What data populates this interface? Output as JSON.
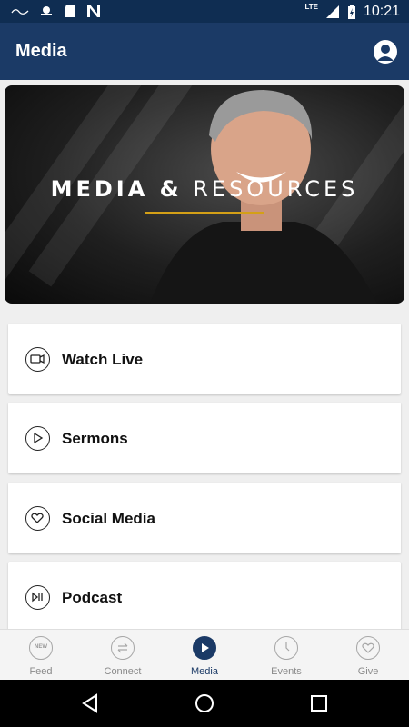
{
  "status_bar": {
    "network": "LTE",
    "time": "10:21"
  },
  "app_bar": {
    "title": "Media",
    "profile_icon": "account-circle-icon"
  },
  "hero": {
    "title_bold": "MEDIA &",
    "title_light": "RESOURCES",
    "accent_color": "#d4a017"
  },
  "menu": [
    {
      "label": "Watch Live",
      "icon": "video-camera-icon"
    },
    {
      "label": "Sermons",
      "icon": "play-icon"
    },
    {
      "label": "Social Media",
      "icon": "heart-icon"
    },
    {
      "label": "Podcast",
      "icon": "play-pause-icon"
    }
  ],
  "bottom_nav": [
    {
      "label": "Feed",
      "icon": "new-badge-icon",
      "icon_text": "NEW",
      "active": false
    },
    {
      "label": "Connect",
      "icon": "swap-arrows-icon",
      "active": false
    },
    {
      "label": "Media",
      "icon": "play-icon",
      "active": true
    },
    {
      "label": "Events",
      "icon": "clock-icon",
      "active": false
    },
    {
      "label": "Give",
      "icon": "heart-icon",
      "active": false
    }
  ],
  "colors": {
    "primary": "#1b3a66",
    "status_bar": "#0f2d52"
  }
}
